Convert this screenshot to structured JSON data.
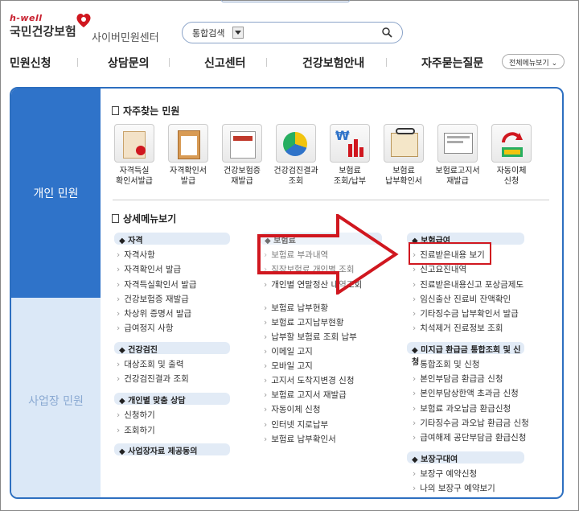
{
  "header": {
    "brand_small": "h-well",
    "brand_name": "국민건강보험",
    "center_name": "사이버민원센터",
    "search_scope": "통합검색",
    "all_menu": "전체메뉴보기"
  },
  "gnb": [
    "민원신청",
    "상담문의",
    "신고센터",
    "건강보험안내",
    "자주묻는질문"
  ],
  "sidebar": {
    "personal": "개인 민원",
    "business": "사업장 민원"
  },
  "frequent": {
    "title": "자주찾는 민원",
    "items": [
      {
        "line1": "자격득실",
        "line2": "확인서발급"
      },
      {
        "line1": "자격확인서",
        "line2": "발급"
      },
      {
        "line1": "건강보험증",
        "line2": "재발급"
      },
      {
        "line1": "건강검진결과",
        "line2": "조회"
      },
      {
        "line1": "보험료",
        "line2": "조회/납부"
      },
      {
        "line1": "보험료",
        "line2": "납부확인서"
      },
      {
        "line1": "보험료고지서",
        "line2": "재발급"
      },
      {
        "line1": "자동이체",
        "line2": "신청"
      }
    ]
  },
  "detail": {
    "title": "상세메뉴보기",
    "col1": {
      "cat1": "자격",
      "links1": [
        "자격사항",
        "자격확인서 발급",
        "자격득실확인서 발급",
        "건강보험증 재발급",
        "차상위 증명서 발급",
        "급여정지 사항"
      ],
      "cat2": "건강검진",
      "links2": [
        "대상조회 및 출력",
        "건강검진결과 조회"
      ],
      "cat3": "개인별 맞춤 상담",
      "links3": [
        "신청하기",
        "조회하기"
      ],
      "cat4": "사업장자료 제공동의"
    },
    "col2": {
      "cat1": "보험료",
      "links1": [
        "보험료 부과내역",
        "직장보험료 개인별 조회",
        "개인별 연말정산 내역조회"
      ],
      "links2": [
        "보험료 납부현황",
        "보험료 고지납부현황",
        "납부할 보험료 조회 납부",
        "이메일 고지",
        "모바일 고지",
        "고지서 도착지변경 신청",
        "보험료 고지서 재발급",
        "자동이체 신청",
        "인터넷 지로납부",
        "보험료 납부확인서"
      ]
    },
    "col3": {
      "cat1": "보험급여",
      "links1": [
        "진료받은내용 보기",
        "신고요진내역",
        "진료받은내용신고 포상금제도",
        "임신출산 진료비 잔액확인",
        "기타징수금 납부확인서 발급",
        "치석제거 진료정보 조회"
      ],
      "cat2": "미지급 환급금 통합조회 및 신청",
      "links2": [
        "통합조회 및 신청",
        "본인부담금 환급금 신청",
        "본인부담상한액 초과금 신청",
        "보험료 과오납금 환급신청",
        "기타징수금 과오납 환급금 신청",
        "급여해제 공단부담금 환급신청"
      ],
      "cat3": "보장구대여",
      "links3": [
        "보장구 예약신청",
        "나의 보장구 예약보기"
      ]
    }
  },
  "colors": {
    "accent": "#2f73c9",
    "highlight": "#d0171f"
  }
}
